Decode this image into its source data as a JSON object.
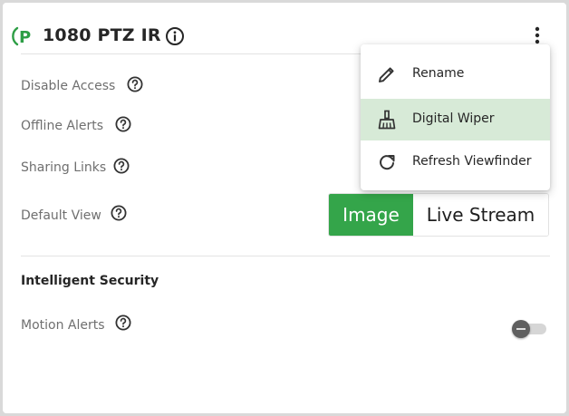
{
  "camera": {
    "title": "1080 PTZ IR"
  },
  "settings": {
    "rows": [
      {
        "label": "Disable Access"
      },
      {
        "label": "Offline Alerts"
      },
      {
        "label": "Sharing Links"
      },
      {
        "label": "Default View"
      }
    ],
    "default_view": {
      "options": [
        "Image",
        "Live Stream"
      ],
      "selected": "Image"
    }
  },
  "intelligent_security": {
    "title": "Intelligent Security",
    "motion_alerts": {
      "label": "Motion Alerts",
      "enabled": false
    }
  },
  "menu": {
    "items": [
      {
        "label": "Rename",
        "icon": "pencil-icon"
      },
      {
        "label": "Digital Wiper",
        "icon": "broom-icon",
        "highlighted": true
      },
      {
        "label": "Refresh Viewfinder",
        "icon": "refresh-icon"
      }
    ]
  },
  "colors": {
    "accent": "#34a54a",
    "menu_highlight": "#d7ead7",
    "text_primary": "#262626",
    "text_secondary": "#6f6f6f"
  }
}
